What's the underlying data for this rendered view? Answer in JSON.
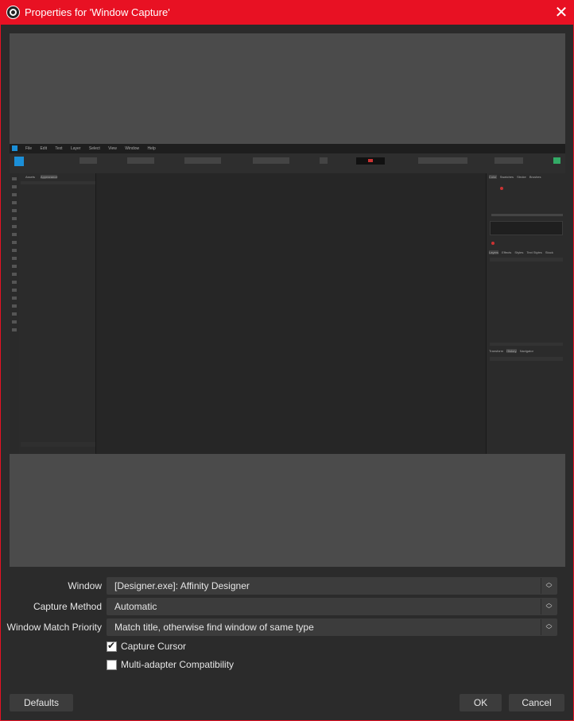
{
  "titlebar": {
    "title": "Properties for 'Window Capture'",
    "close_glyph": "✕"
  },
  "preview": {
    "captured_app_menu": [
      "File",
      "Edit",
      "Text",
      "Layer",
      "Select",
      "View",
      "Window",
      "Help"
    ],
    "captured_left_tabs": [
      "Assets",
      "Appearance"
    ],
    "captured_right_tabs_top": [
      "Color",
      "Swatches",
      "Stroke",
      "Brushes"
    ],
    "captured_right_tabs_mid": [
      "Layers",
      "Effects",
      "Styles",
      "Text Styles",
      "Stock"
    ],
    "captured_right_tabs_bottom": [
      "Transform",
      "History",
      "Navigator"
    ]
  },
  "form": {
    "window_label": "Window",
    "window_value": "[Designer.exe]: Affinity Designer",
    "capture_method_label": "Capture Method",
    "capture_method_value": "Automatic",
    "match_priority_label": "Window Match Priority",
    "match_priority_value": "Match title, otherwise find window of same type",
    "capture_cursor_label": "Capture Cursor",
    "capture_cursor_checked": true,
    "multi_adapter_label": "Multi-adapter Compatibility",
    "multi_adapter_checked": false
  },
  "buttons": {
    "defaults": "Defaults",
    "ok": "OK",
    "cancel": "Cancel"
  },
  "colors": {
    "titlebar": "#e81123",
    "background": "#2b2b2b",
    "preview_background": "#4b4b4b",
    "control": "#3c3c3c",
    "text": "#e6e6e6"
  }
}
